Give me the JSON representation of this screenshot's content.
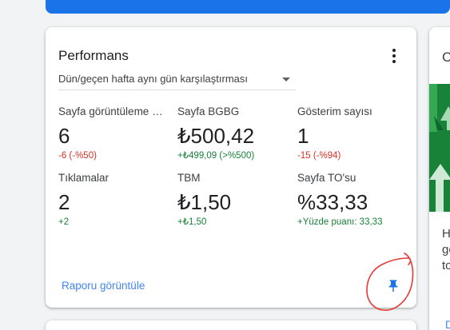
{
  "card": {
    "title": "Performans",
    "comparison_select": "Dün/geçen hafta aynı gün karşılaştırması",
    "report_link": "Raporu görüntüle"
  },
  "metrics": [
    {
      "label": "Sayfa görüntüleme sayısı",
      "value": "6",
      "delta": "-6 (-%50)",
      "trend": "negative"
    },
    {
      "label": "Sayfa BGBG",
      "value": "₺500,42",
      "delta": "+₺499,09 (>%500)",
      "trend": "positive"
    },
    {
      "label": "Gösterim sayısı",
      "value": "1",
      "delta": "-15 (-%94)",
      "trend": "negative"
    },
    {
      "label": "Tıklamalar",
      "value": "2",
      "delta": "+2",
      "trend": "positive"
    },
    {
      "label": "TBM",
      "value": "₺1,50",
      "delta": "+₺1,50",
      "trend": "positive"
    },
    {
      "label": "Sayfa TO'su",
      "value": "%33,33",
      "delta": "+Yüzde puanı: 33,33",
      "trend": "positive"
    }
  ],
  "side_card": {
    "title_letter": "C",
    "text_lines": [
      "H",
      "ge",
      "to"
    ],
    "link_letter": "D"
  },
  "icons": {
    "menu": "more-vert-icon",
    "dropdown": "chevron-down-icon",
    "pin": "pin-icon"
  },
  "colors": {
    "accent": "#1a73e8",
    "link": "#4285f4",
    "negative": "#d93025",
    "positive": "#188038",
    "annotation": "#e53935"
  }
}
